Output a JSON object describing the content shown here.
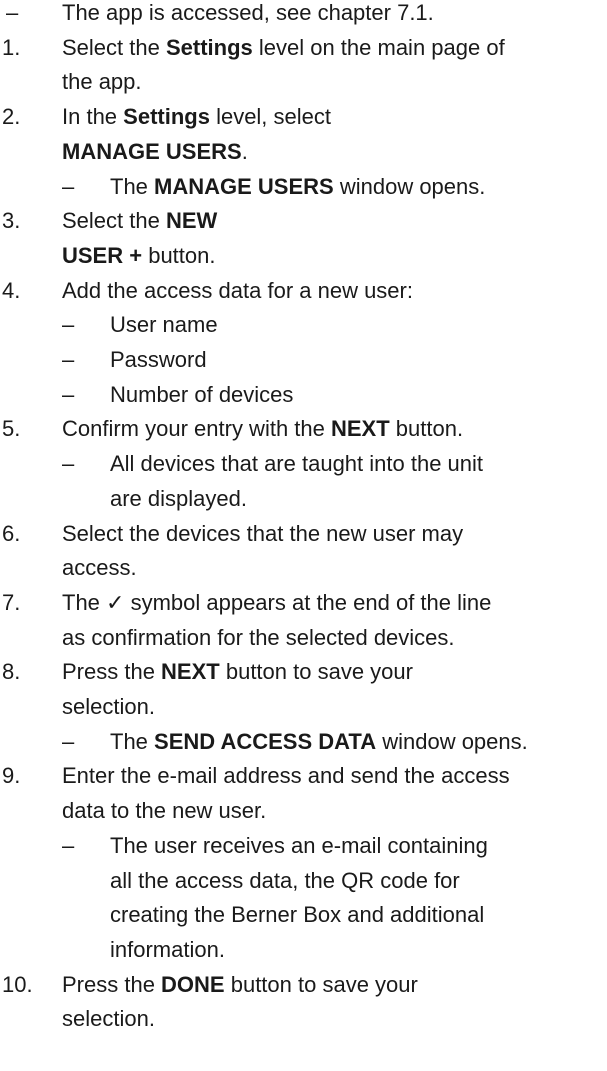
{
  "lines": [
    {
      "m": "–",
      "lvl": 0,
      "parts": [
        [
          "The app is accessed, see chapter 7.1.",
          0
        ]
      ]
    },
    {
      "m": "1.",
      "lvl": 1,
      "parts": [
        [
          "Select the ",
          0
        ],
        [
          "Settings",
          1
        ],
        [
          " level on the main page of",
          0
        ]
      ]
    },
    {
      "m": "",
      "lvl": 1,
      "parts": [
        [
          "the app.",
          0
        ]
      ]
    },
    {
      "m": "2.",
      "lvl": 1,
      "parts": [
        [
          "In the ",
          0
        ],
        [
          "Settings",
          1
        ],
        [
          " level, select",
          0
        ]
      ]
    },
    {
      "m": "",
      "lvl": 1,
      "parts": [
        [
          "MANAGE USERS",
          1
        ],
        [
          ".",
          0
        ]
      ]
    },
    {
      "m": "–",
      "lvl": 2,
      "parts": [
        [
          "The ",
          0
        ],
        [
          "MANAGE USERS",
          1
        ],
        [
          " window opens.",
          0
        ]
      ]
    },
    {
      "m": "3.",
      "lvl": 1,
      "parts": [
        [
          "Select the ",
          0
        ],
        [
          "NEW",
          1
        ]
      ]
    },
    {
      "m": "",
      "lvl": 1,
      "parts": [
        [
          "USER +",
          1
        ],
        [
          " button.",
          0
        ]
      ]
    },
    {
      "m": "4.",
      "lvl": 1,
      "parts": [
        [
          "Add the access data for a new user:",
          0
        ]
      ]
    },
    {
      "m": "–",
      "lvl": 2,
      "parts": [
        [
          "User name",
          0
        ]
      ]
    },
    {
      "m": "–",
      "lvl": 2,
      "parts": [
        [
          "Password",
          0
        ]
      ]
    },
    {
      "m": "–",
      "lvl": 2,
      "parts": [
        [
          "Number of devices",
          0
        ]
      ]
    },
    {
      "m": "5.",
      "lvl": 1,
      "parts": [
        [
          "Confirm your entry with the ",
          0
        ],
        [
          "NEXT",
          1
        ],
        [
          " button.",
          0
        ]
      ]
    },
    {
      "m": "–",
      "lvl": 2,
      "parts": [
        [
          "All devices that are taught into the unit",
          0
        ]
      ]
    },
    {
      "m": "",
      "lvl": 2,
      "parts": [
        [
          "are displayed.",
          0
        ]
      ]
    },
    {
      "m": "6.",
      "lvl": 1,
      "parts": [
        [
          "Select the devices that the new user may",
          0
        ]
      ]
    },
    {
      "m": "",
      "lvl": 1,
      "parts": [
        [
          "access.",
          0
        ]
      ]
    },
    {
      "m": "7.",
      "lvl": 1,
      "parts": [
        [
          "The ✓ symbol appears at the end of the line",
          0
        ]
      ]
    },
    {
      "m": "",
      "lvl": 1,
      "parts": [
        [
          "as confirmation for the selected devices.",
          0
        ]
      ]
    },
    {
      "m": "8.",
      "lvl": 1,
      "parts": [
        [
          "Press the ",
          0
        ],
        [
          "NEXT",
          1
        ],
        [
          " button to save your",
          0
        ]
      ]
    },
    {
      "m": "",
      "lvl": 1,
      "parts": [
        [
          "selection.",
          0
        ]
      ]
    },
    {
      "m": "–",
      "lvl": 2,
      "parts": [
        [
          "The ",
          0
        ],
        [
          "SEND ACCESS DATA",
          1
        ],
        [
          " window opens.",
          0
        ]
      ]
    },
    {
      "m": "9.",
      "lvl": 1,
      "parts": [
        [
          "Enter the e-mail address and send the access",
          0
        ]
      ]
    },
    {
      "m": "",
      "lvl": 1,
      "parts": [
        [
          "data to the new user.",
          0
        ]
      ]
    },
    {
      "m": "–",
      "lvl": 2,
      "parts": [
        [
          "The user receives an e-mail containing",
          0
        ]
      ]
    },
    {
      "m": "",
      "lvl": 2,
      "parts": [
        [
          "all the access data, the QR code for",
          0
        ]
      ]
    },
    {
      "m": "",
      "lvl": 2,
      "parts": [
        [
          "creating the Berner Box and additional",
          0
        ]
      ]
    },
    {
      "m": "",
      "lvl": 2,
      "parts": [
        [
          "information.",
          0
        ]
      ]
    },
    {
      "m": "10.",
      "lvl": 1,
      "parts": [
        [
          "Press the ",
          0
        ],
        [
          "DONE",
          1
        ],
        [
          " button to save your",
          0
        ]
      ]
    },
    {
      "m": "",
      "lvl": 1,
      "parts": [
        [
          "selection.",
          0
        ]
      ]
    }
  ]
}
